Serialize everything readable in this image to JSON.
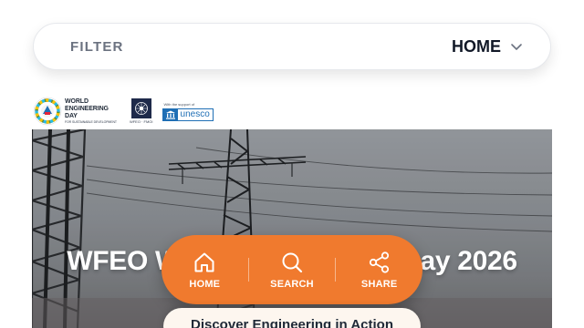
{
  "filter": {
    "label": "FILTER",
    "selected": "HOME"
  },
  "logos": {
    "world_engineering_day": {
      "line1": "WORLD",
      "line2": "ENGINEERING",
      "line3": "DAY",
      "sub": "FOR SUSTAINABLE DEVELOPMENT"
    },
    "wfeo": {
      "caption": "WFEO · FMOI"
    },
    "unesco": {
      "small": "With the support of",
      "word": "unesco"
    }
  },
  "hero": {
    "title": "WFEO World Engineering Day 2026"
  },
  "nav": {
    "items": [
      {
        "label": "HOME",
        "icon": "home-icon"
      },
      {
        "label": "SEARCH",
        "icon": "search-icon"
      },
      {
        "label": "SHARE",
        "icon": "share-icon"
      }
    ],
    "color": "#f07a2e"
  },
  "cta": {
    "label": "Discover Engineering in Action"
  }
}
